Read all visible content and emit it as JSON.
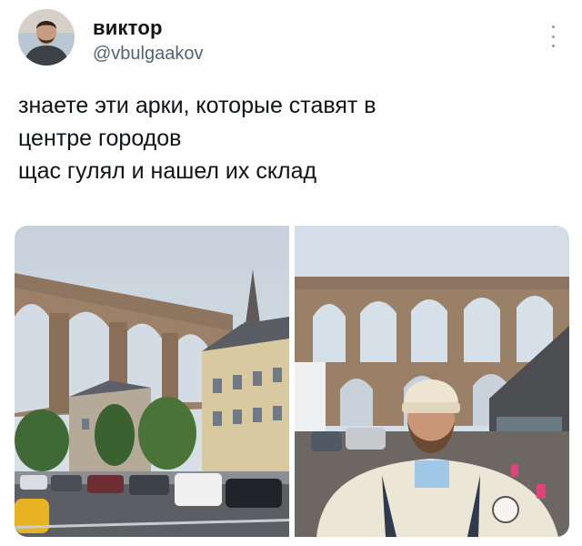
{
  "author": {
    "display_name": "виктор",
    "handle": "@vbulgaakov"
  },
  "tweet": {
    "lines": [
      "знаете эти арки, которые ставят в",
      "центре городов",
      "щас гулял и нашел их склад"
    ]
  },
  "media": [
    {
      "subject": "viaduct-over-town-square"
    },
    {
      "subject": "selfie-under-viaduct"
    }
  ],
  "colors": {
    "text": "#0f1419",
    "secondary_text": "#536471",
    "stone": "#9c8068",
    "sky": "#cfd9e2"
  }
}
